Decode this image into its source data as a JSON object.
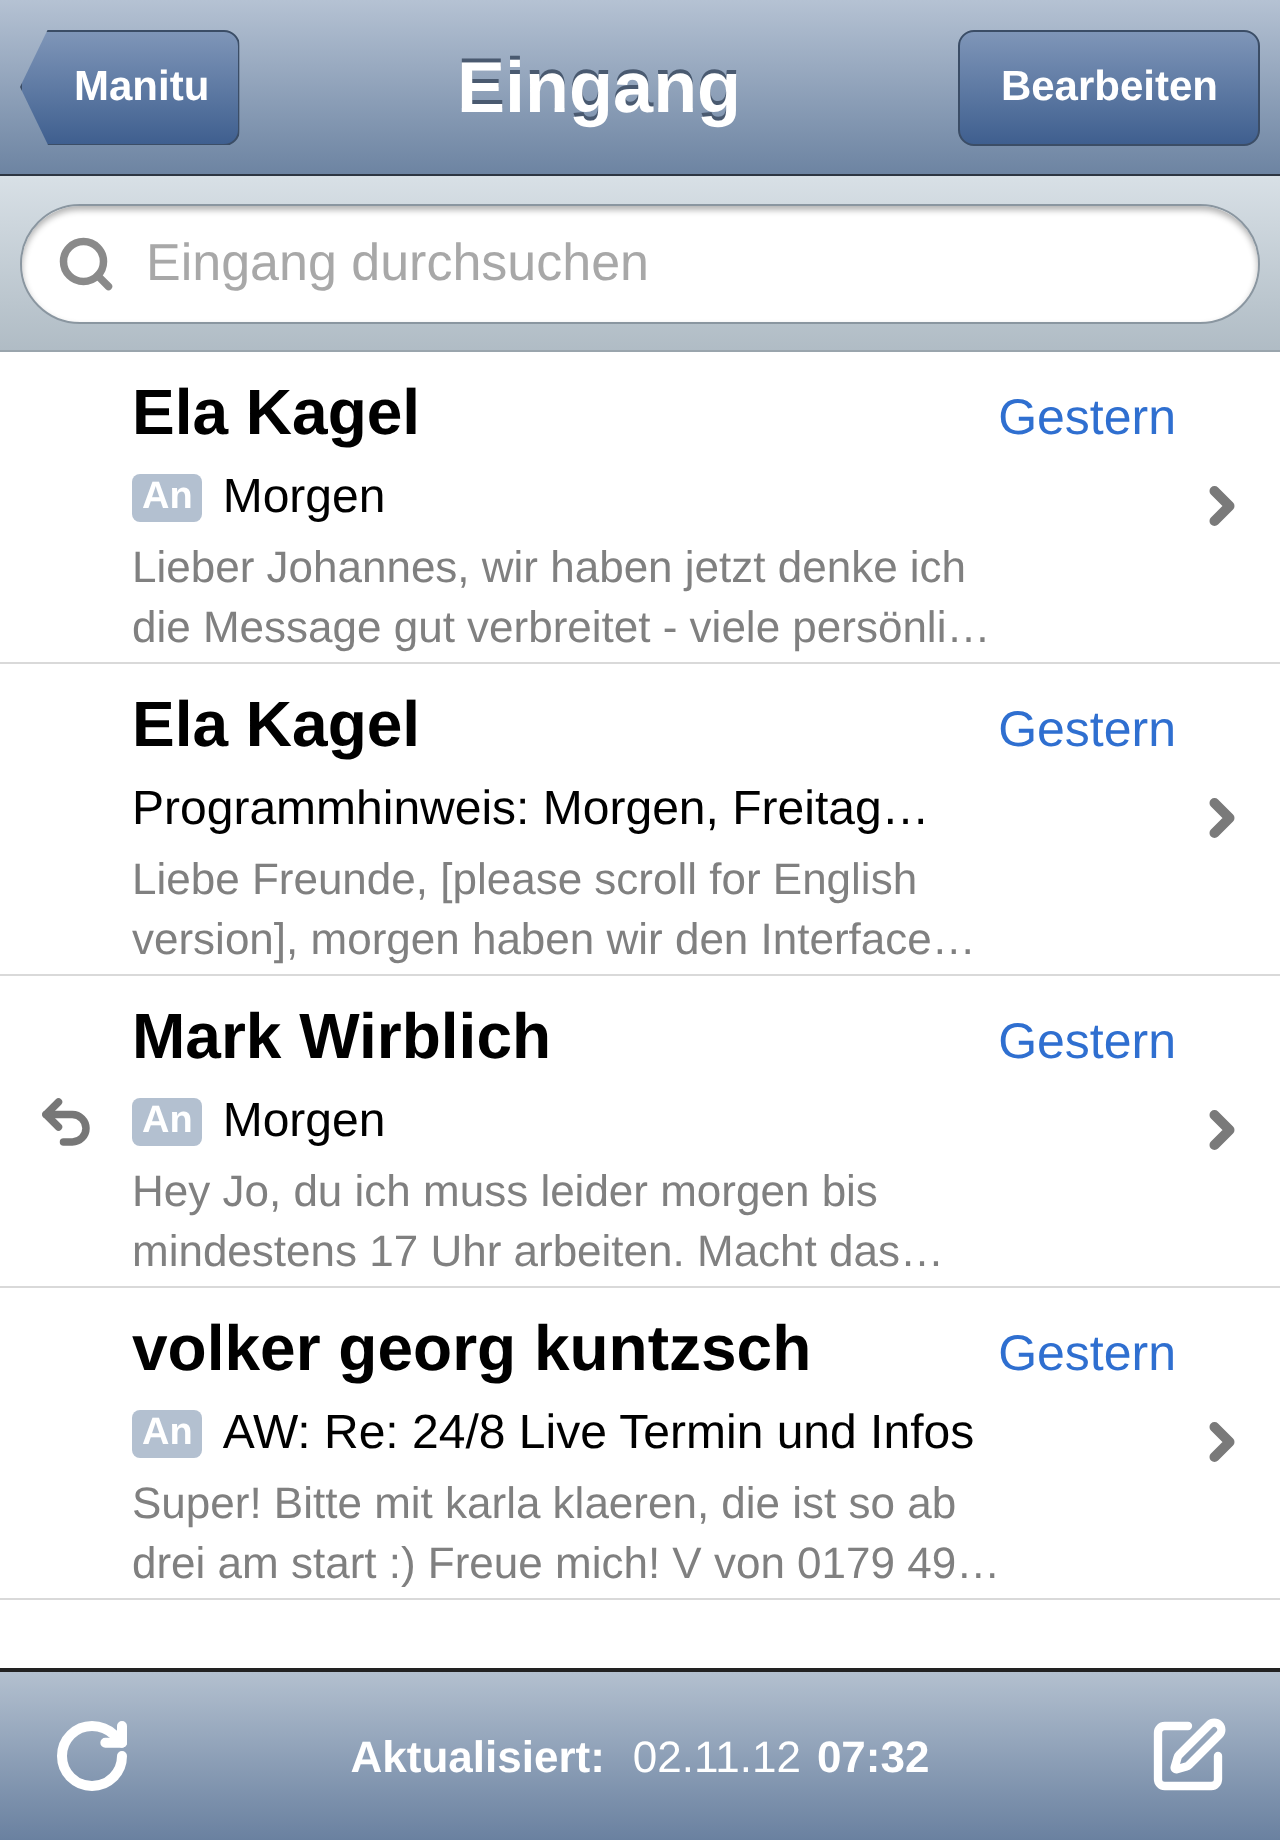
{
  "nav_bar": {
    "back_button": "Manitu",
    "title": "Eingang",
    "edit_button": "Bearbeiten"
  },
  "search": {
    "placeholder": "Eingang durchsuchen"
  },
  "messages": [
    {
      "sender": "Ela Kagel",
      "date": "Gestern",
      "badge": "An",
      "subject": "Morgen",
      "preview_lines": [
        "Lieber Johannes, wir haben jetzt denke ich",
        "die Message gut verbreitet - viele persönli…"
      ],
      "replied": false
    },
    {
      "sender": "Ela Kagel",
      "date": "Gestern",
      "subject": "Programmhinweis: Morgen, Freitag…",
      "preview_lines": [
        "Liebe Freunde, [please scroll for English",
        "version], morgen haben wir den Interface…"
      ],
      "replied": false
    },
    {
      "sender": "Mark Wirblich",
      "date": "Gestern",
      "badge": "An",
      "subject": "Morgen",
      "preview_lines": [
        "Hey Jo, du ich muss leider morgen bis",
        "mindestens 17 Uhr arbeiten. Macht das…"
      ],
      "replied": true
    },
    {
      "sender": "volker georg kuntzsch",
      "date": "Gestern",
      "badge": "An",
      "subject": "AW: Re: 24/8 Live Termin und Infos",
      "preview_lines": [
        "Super! Bitte mit karla klaeren, die ist so ab",
        "drei am start :) Freue mich! V von 0179 49…"
      ],
      "replied": false
    }
  ],
  "toolbar": {
    "status_label": "Aktualisiert:",
    "status_date": "02.11.12",
    "status_time": "07:32"
  }
}
